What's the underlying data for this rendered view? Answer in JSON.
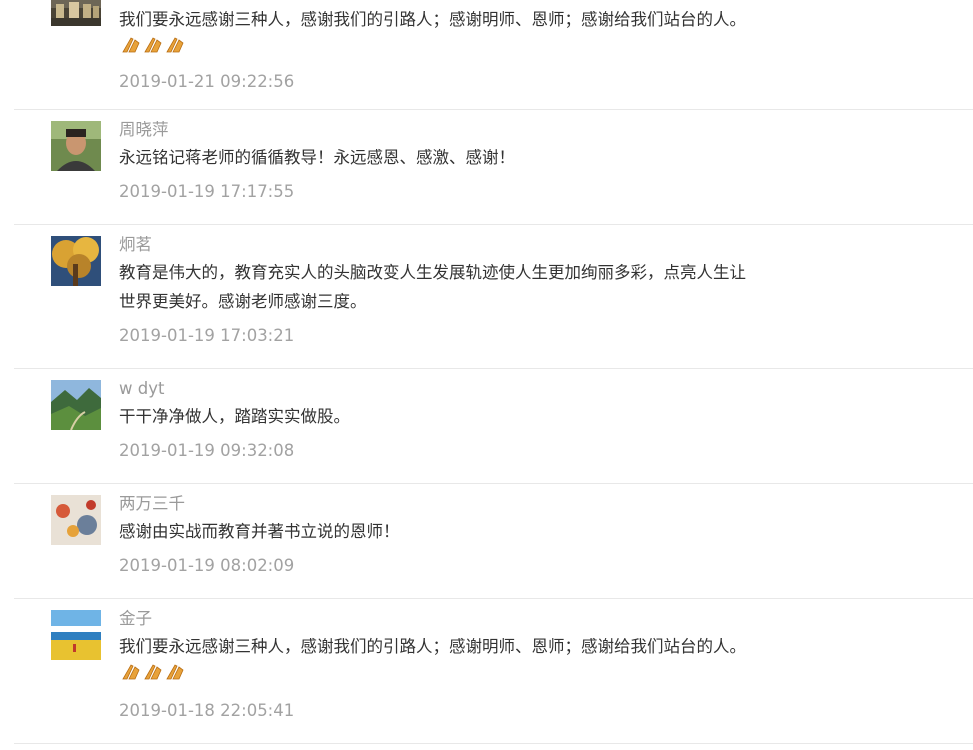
{
  "comments": [
    {
      "author": "",
      "text": "我们要永远感谢三种人，感谢我们的引路人；感谢明师、恩师；感谢给我们站台的人。",
      "emoji_count": 3,
      "time": "2019-01-21 09:22:56",
      "avatar_icon": "castle-photo-avatar"
    },
    {
      "author": "周晓萍",
      "text": "永远铭记蒋老师的循循教导！永远感恩、感激、感谢！",
      "emoji_count": 0,
      "time": "2019-01-19 17:17:55",
      "avatar_icon": "man-portrait-avatar"
    },
    {
      "author": "炯茗",
      "text": "教育是伟大的，教育充实人的头脑改变人生发展轨迹使人生更加绚丽多彩，点亮人生让世界更美好。感谢老师感谢三度。",
      "emoji_count": 0,
      "time": "2019-01-19 17:03:21",
      "avatar_icon": "autumn-tree-avatar"
    },
    {
      "author": "w dyt",
      "text": "干干净净做人，踏踏实实做股。",
      "emoji_count": 0,
      "time": "2019-01-19 09:32:08",
      "avatar_icon": "mountain-valley-avatar"
    },
    {
      "author": "两万三千",
      "text": "感谢由实战而教育并著书立说的恩师！",
      "emoji_count": 0,
      "time": "2019-01-19 08:02:09",
      "avatar_icon": "cartoon-avatar"
    },
    {
      "author": "金子",
      "text": "我们要永远感谢三种人，感谢我们的引路人；感谢明师、恩师；感谢给我们站台的人。",
      "emoji_count": 3,
      "time": "2019-01-18 22:05:41",
      "avatar_icon": "lake-field-avatar"
    }
  ]
}
